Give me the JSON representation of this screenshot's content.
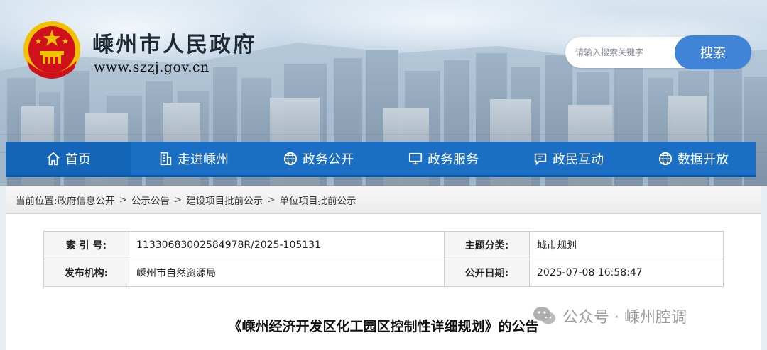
{
  "site": {
    "title": "嵊州市人民政府",
    "url": "www.szzj.gov.cn"
  },
  "search": {
    "placeholder": "请输入搜索关键字",
    "button_label": "搜索"
  },
  "nav": {
    "items": [
      {
        "label": "首页",
        "icon": "home-icon"
      },
      {
        "label": "走进嵊州",
        "icon": "building-icon"
      },
      {
        "label": "政务公开",
        "icon": "globe-icon"
      },
      {
        "label": "政务服务",
        "icon": "monitor-icon"
      },
      {
        "label": "政民互动",
        "icon": "chat-icon"
      },
      {
        "label": "数据开放",
        "icon": "globe-icon"
      }
    ]
  },
  "breadcrumb": {
    "prefix": "当前位置:",
    "items": [
      "政府信息公开",
      "公示公告",
      "建设项目批前公示",
      "单位项目批前公示"
    ]
  },
  "info": {
    "index_label": "索 引 号:",
    "index_value": "11330683002584978R/2025-105131",
    "topic_label": "主题分类:",
    "topic_value": "城市规划",
    "publisher_label": "发布机构:",
    "publisher_value": "嵊州市自然资源局",
    "date_label": "公开日期:",
    "date_value": "2025-07-08 16:58:47"
  },
  "document": {
    "title": "《嵊州经济开发区化工园区控制性详细规划》的公告"
  },
  "watermark": {
    "text": "公众号 · 嵊州腔调"
  },
  "colors": {
    "nav": "#1a6ec4",
    "search_button": "#3f84d6",
    "emblem_red": "#d0111b",
    "emblem_gold": "#f2c200"
  }
}
